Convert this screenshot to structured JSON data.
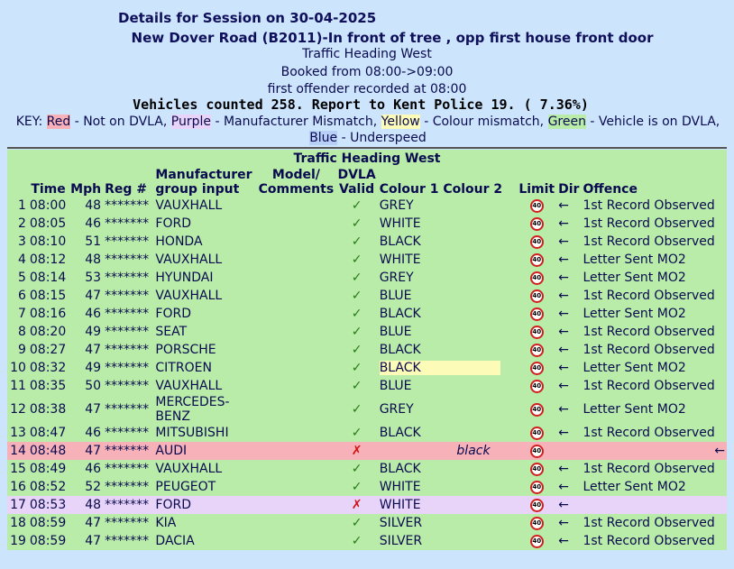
{
  "header": {
    "title": "Details for Session on 30-04-2025",
    "location": "New Dover Road (B2011)-In front of tree , opp first house front door",
    "direction": "Traffic Heading West",
    "booked": "Booked from 08:00->09:00",
    "first_offender": "first offender recorded at 08:00",
    "counted": "Vehicles counted 258. Report to Kent Police 19. ( 7.36%)"
  },
  "key": {
    "prefix": "KEY: ",
    "red": "Red",
    "red_desc": " - Not on DVLA, ",
    "purple": "Purple",
    "purple_desc": " - Manufacturer Mismatch, ",
    "yellow": "Yellow",
    "yellow_desc": " - Colour mismatch, ",
    "green": "Green",
    "green_desc": " - Vehicle is on DVLA, ",
    "blue": "Blue",
    "blue_desc": " - Underspeed"
  },
  "table": {
    "caption": "Traffic Heading West",
    "headers": {
      "time": "Time",
      "mph": "Mph",
      "reg": "Reg #",
      "manu_1": "Manufacturer",
      "manu_2": "group input",
      "model_1": "Model/",
      "model_2": "Comments",
      "dvla_1": "DVLA",
      "dvla_2": "Valid",
      "colour1": "Colour 1",
      "colour2": "Colour 2",
      "limit": "Limit",
      "dir": "Dir",
      "offence": "Offence"
    },
    "limit_sign": "40",
    "rows": [
      {
        "n": "1",
        "time": "08:00",
        "mph": "48",
        "reg": "*******",
        "manu": "VAUXHALL",
        "valid": "✓",
        "c1": "GREY",
        "dir": "←",
        "off": "1st Record Observed"
      },
      {
        "n": "2",
        "time": "08:05",
        "mph": "46",
        "reg": "*******",
        "manu": "FORD",
        "valid": "✓",
        "c1": "WHITE",
        "dir": "←",
        "off": "1st Record Observed"
      },
      {
        "n": "3",
        "time": "08:10",
        "mph": "51",
        "reg": "*******",
        "manu": "HONDA",
        "valid": "✓",
        "c1": "BLACK",
        "dir": "←",
        "off": "1st Record Observed"
      },
      {
        "n": "4",
        "time": "08:12",
        "mph": "48",
        "reg": "*******",
        "manu": "VAUXHALL",
        "valid": "✓",
        "c1": "WHITE",
        "dir": "←",
        "off": "Letter Sent MO2"
      },
      {
        "n": "5",
        "time": "08:14",
        "mph": "53",
        "reg": "*******",
        "manu": "HYUNDAI",
        "valid": "✓",
        "c1": "GREY",
        "dir": "←",
        "off": "Letter Sent MO2"
      },
      {
        "n": "6",
        "time": "08:15",
        "mph": "47",
        "reg": "*******",
        "manu": "VAUXHALL",
        "valid": "✓",
        "c1": "BLUE",
        "dir": "←",
        "off": "1st Record Observed"
      },
      {
        "n": "7",
        "time": "08:16",
        "mph": "46",
        "reg": "*******",
        "manu": "FORD",
        "valid": "✓",
        "c1": "BLACK",
        "dir": "←",
        "off": "Letter Sent MO2"
      },
      {
        "n": "8",
        "time": "08:20",
        "mph": "49",
        "reg": "*******",
        "manu": "SEAT",
        "valid": "✓",
        "c1": "BLUE",
        "dir": "←",
        "off": "1st Record Observed"
      },
      {
        "n": "9",
        "time": "08:27",
        "mph": "47",
        "reg": "*******",
        "manu": "PORSCHE",
        "valid": "✓",
        "c1": "BLACK",
        "dir": "←",
        "off": "1st Record Observed"
      },
      {
        "n": "10",
        "time": "08:32",
        "mph": "49",
        "reg": "*******",
        "manu": "CITROEN",
        "valid": "✓",
        "c1": "BLACK",
        "dir": "←",
        "off": "Letter Sent MO2",
        "c1_style": "yellow"
      },
      {
        "n": "11",
        "time": "08:35",
        "mph": "50",
        "reg": "*******",
        "manu": "VAUXHALL",
        "valid": "✓",
        "c1": "BLUE",
        "dir": "←",
        "off": "1st Record Observed"
      },
      {
        "n": "12",
        "time": "08:38",
        "mph": "47",
        "reg": "*******",
        "manu": "MERCEDES-BENZ",
        "valid": "✓",
        "c1": "GREY",
        "dir": "←",
        "off": "Letter Sent MO2"
      },
      {
        "n": "13",
        "time": "08:47",
        "mph": "46",
        "reg": "*******",
        "manu": "MITSUBISHI",
        "valid": "✓",
        "c1": "BLACK",
        "dir": "←",
        "off": "1st Record Observed"
      },
      {
        "n": "14",
        "time": "08:48",
        "mph": "47",
        "reg": "*******",
        "manu": "AUDI",
        "valid": "✗",
        "c1": "black",
        "dir": "←",
        "off": "",
        "row_style": "red"
      },
      {
        "n": "15",
        "time": "08:49",
        "mph": "46",
        "reg": "*******",
        "manu": "VAUXHALL",
        "valid": "✓",
        "c1": "BLACK",
        "dir": "←",
        "off": "1st Record Observed"
      },
      {
        "n": "16",
        "time": "08:52",
        "mph": "52",
        "reg": "*******",
        "manu": "PEUGEOT",
        "valid": "✓",
        "c1": "WHITE",
        "dir": "←",
        "off": "Letter Sent MO2"
      },
      {
        "n": "17",
        "time": "08:53",
        "mph": "48",
        "reg": "*******",
        "manu": "FORD",
        "valid": "✗",
        "c1": "WHITE",
        "dir": "←",
        "off": "",
        "row_style": "purple"
      },
      {
        "n": "18",
        "time": "08:59",
        "mph": "47",
        "reg": "*******",
        "manu": "KIA",
        "valid": "✓",
        "c1": "SILVER",
        "dir": "←",
        "off": "1st Record Observed"
      },
      {
        "n": "19",
        "time": "08:59",
        "mph": "47",
        "reg": "*******",
        "manu": "DACIA",
        "valid": "✓",
        "c1": "SILVER",
        "dir": "←",
        "off": "1st Record Observed"
      }
    ]
  }
}
